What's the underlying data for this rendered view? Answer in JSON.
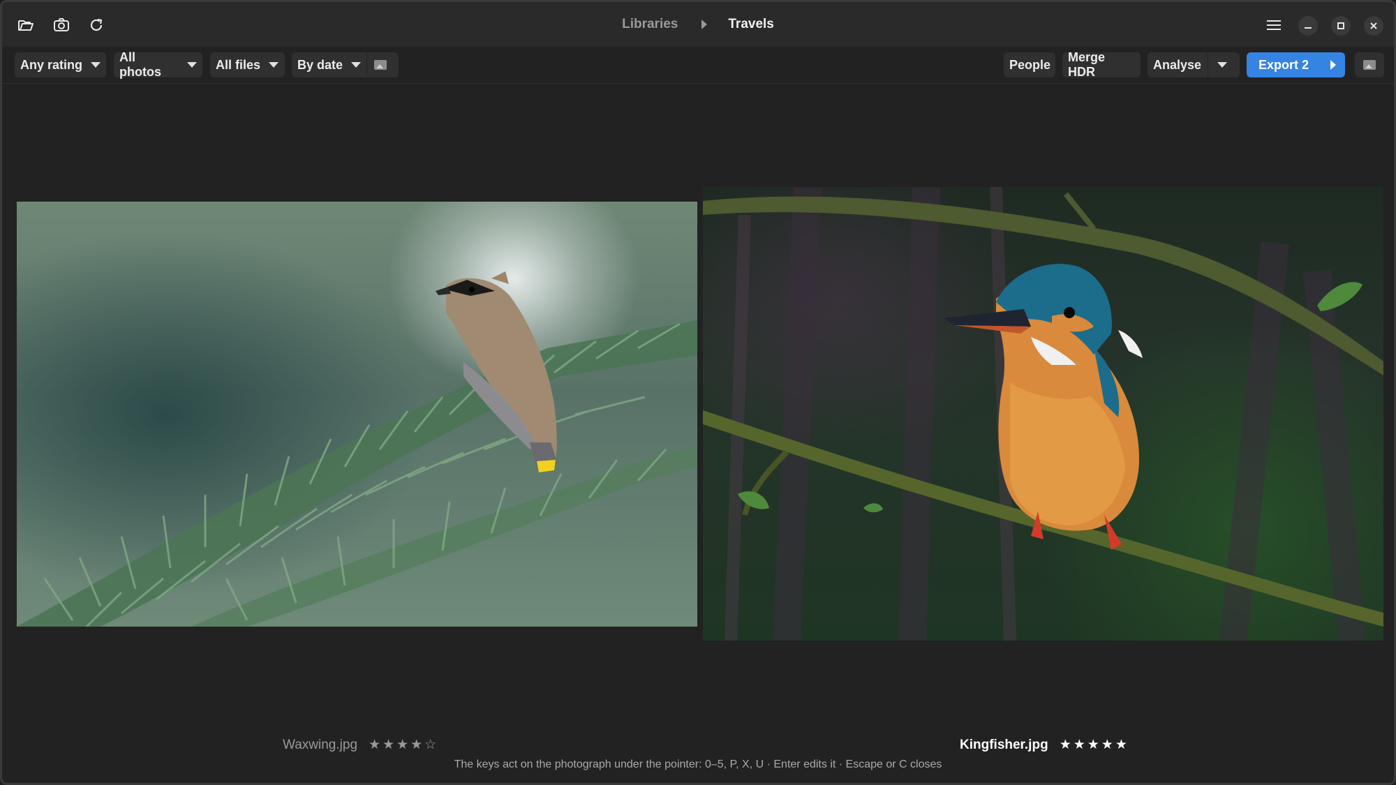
{
  "titlebar": {
    "breadcrumb": {
      "parent": "Libraries",
      "current": "Travels"
    },
    "left_icons": [
      "folder-open-icon",
      "camera-icon",
      "refresh-icon"
    ],
    "right_icons": [
      "menu-icon",
      "minimize-icon",
      "maximize-icon",
      "close-icon"
    ]
  },
  "toolbar": {
    "filters": {
      "rating": "Any rating",
      "photos": "All photos",
      "files": "All files",
      "sort": "By date"
    },
    "actions": {
      "people": "People",
      "merge_hdr": "Merge HDR",
      "analyse": "Analyse",
      "export": "Export 2"
    },
    "icons": [
      "image-view-icon",
      "caret-down-icon",
      "caret-right-icon"
    ]
  },
  "compare": {
    "left": {
      "filename": "Waxwing.jpg",
      "rating_stars": "★★★★☆",
      "rating": 4,
      "selected": false
    },
    "right": {
      "filename": "Kingfisher.jpg",
      "rating_stars": "★★★★★",
      "rating": 5,
      "selected": true
    }
  },
  "hint": "The keys act on the photograph under the pointer: 0–5, P, X, U · Enter edits it · Escape or C closes",
  "colors": {
    "accent": "#3584e4",
    "background": "#222222",
    "button": "#303030"
  }
}
